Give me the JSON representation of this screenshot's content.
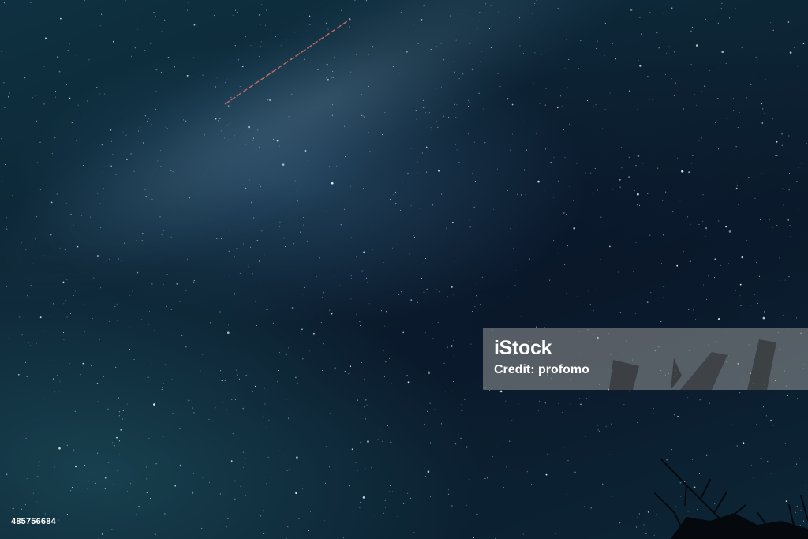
{
  "watermark": {
    "brand": "iStock",
    "credit": "Credit: profomo"
  },
  "image_id": "485756684",
  "colors": {
    "sky_dark": "#0a1b2c",
    "sky_teal": "#0e3140",
    "trail": "#d0706a",
    "watermark_bg": "#969696"
  }
}
